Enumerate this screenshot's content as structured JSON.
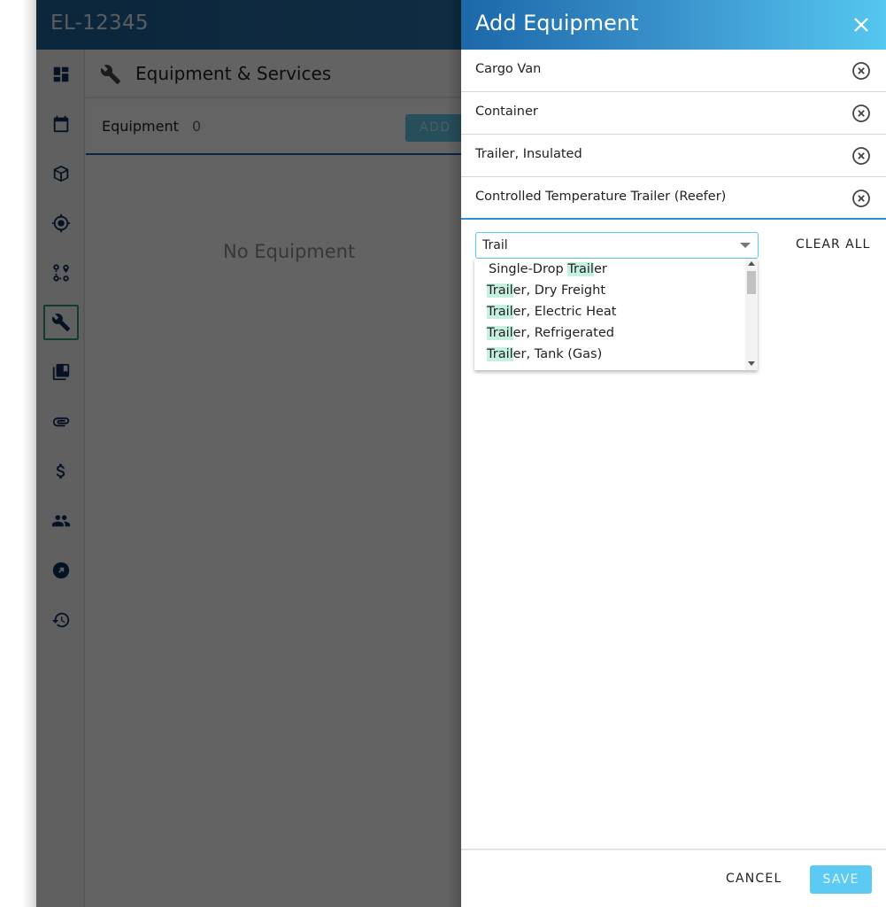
{
  "app": {
    "title": "EL-12345"
  },
  "sidebar": {
    "items": [
      {
        "icon": "dashboard-icon",
        "active": false
      },
      {
        "icon": "calendar-icon",
        "active": false
      },
      {
        "icon": "package-icon",
        "active": false
      },
      {
        "icon": "location-target-icon",
        "active": false
      },
      {
        "icon": "route-stops-icon",
        "active": false
      },
      {
        "icon": "wrench-icon",
        "active": true
      },
      {
        "icon": "library-books-icon",
        "active": false
      },
      {
        "icon": "paperclip-icon",
        "active": false
      },
      {
        "icon": "dollar-icon",
        "active": false
      },
      {
        "icon": "people-icon",
        "active": false
      },
      {
        "icon": "open-external-icon",
        "active": false
      },
      {
        "icon": "history-icon",
        "active": false
      }
    ]
  },
  "main": {
    "section_title": "Equipment & Services",
    "section_icon": "wrench-icon",
    "equipment_label": "Equipment",
    "equipment_count": "0",
    "add_label": "ADD",
    "empty_text": "No Equipment"
  },
  "panel": {
    "title": "Add Equipment",
    "close_icon": "close-icon",
    "selected": [
      {
        "label": "Cargo Van"
      },
      {
        "label": "Container"
      },
      {
        "label": "Trailer, Insulated"
      },
      {
        "label": "Controlled Temperature Trailer (Reefer)"
      }
    ],
    "search": {
      "value": "Trail",
      "placeholder": ""
    },
    "clear_all_label": "CLEAR ALL",
    "options": [
      {
        "before": "Single-Drop ",
        "match": "Trail",
        "after": "er"
      },
      {
        "before": "",
        "match": "Trail",
        "after": "er, Dry Freight"
      },
      {
        "before": "",
        "match": "Trail",
        "after": "er, Electric Heat"
      },
      {
        "before": "",
        "match": "Trail",
        "after": "er, Refrigerated"
      },
      {
        "before": "",
        "match": "Trail",
        "after": "er, Tank (Gas)"
      }
    ],
    "cancel_label": "CANCEL",
    "save_label": "SAVE"
  },
  "colors": {
    "header_dark": "#1e5f94",
    "panel_header_end": "#55c7f0",
    "active_outline": "#2e9a6a",
    "match_highlight": "#c6f1e0",
    "save_button": "#5ccaf2"
  }
}
